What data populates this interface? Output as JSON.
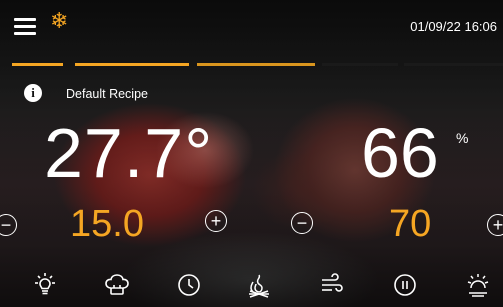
{
  "header": {
    "menu_icon": "hamburger-menu-icon",
    "mode_icon": "snowflake-icon",
    "datetime": "01/09/22 16:06"
  },
  "recipe": {
    "info_icon": "info-icon",
    "name": "Default Recipe"
  },
  "temperature": {
    "current": "27.7°",
    "setpoint": "15.0"
  },
  "humidity": {
    "current": "66",
    "unit": "%",
    "setpoint": "70"
  },
  "colors": {
    "accent": "#f5a623",
    "text": "#ffffff"
  },
  "bottom_bar": [
    {
      "icon": "light-bulb-icon"
    },
    {
      "icon": "chef-hat-icon"
    },
    {
      "icon": "clock-icon"
    },
    {
      "icon": "smoke-fire-icon"
    },
    {
      "icon": "ventilation-icon"
    },
    {
      "icon": "pause-icon"
    },
    {
      "icon": "uv-lamp-icon"
    }
  ]
}
